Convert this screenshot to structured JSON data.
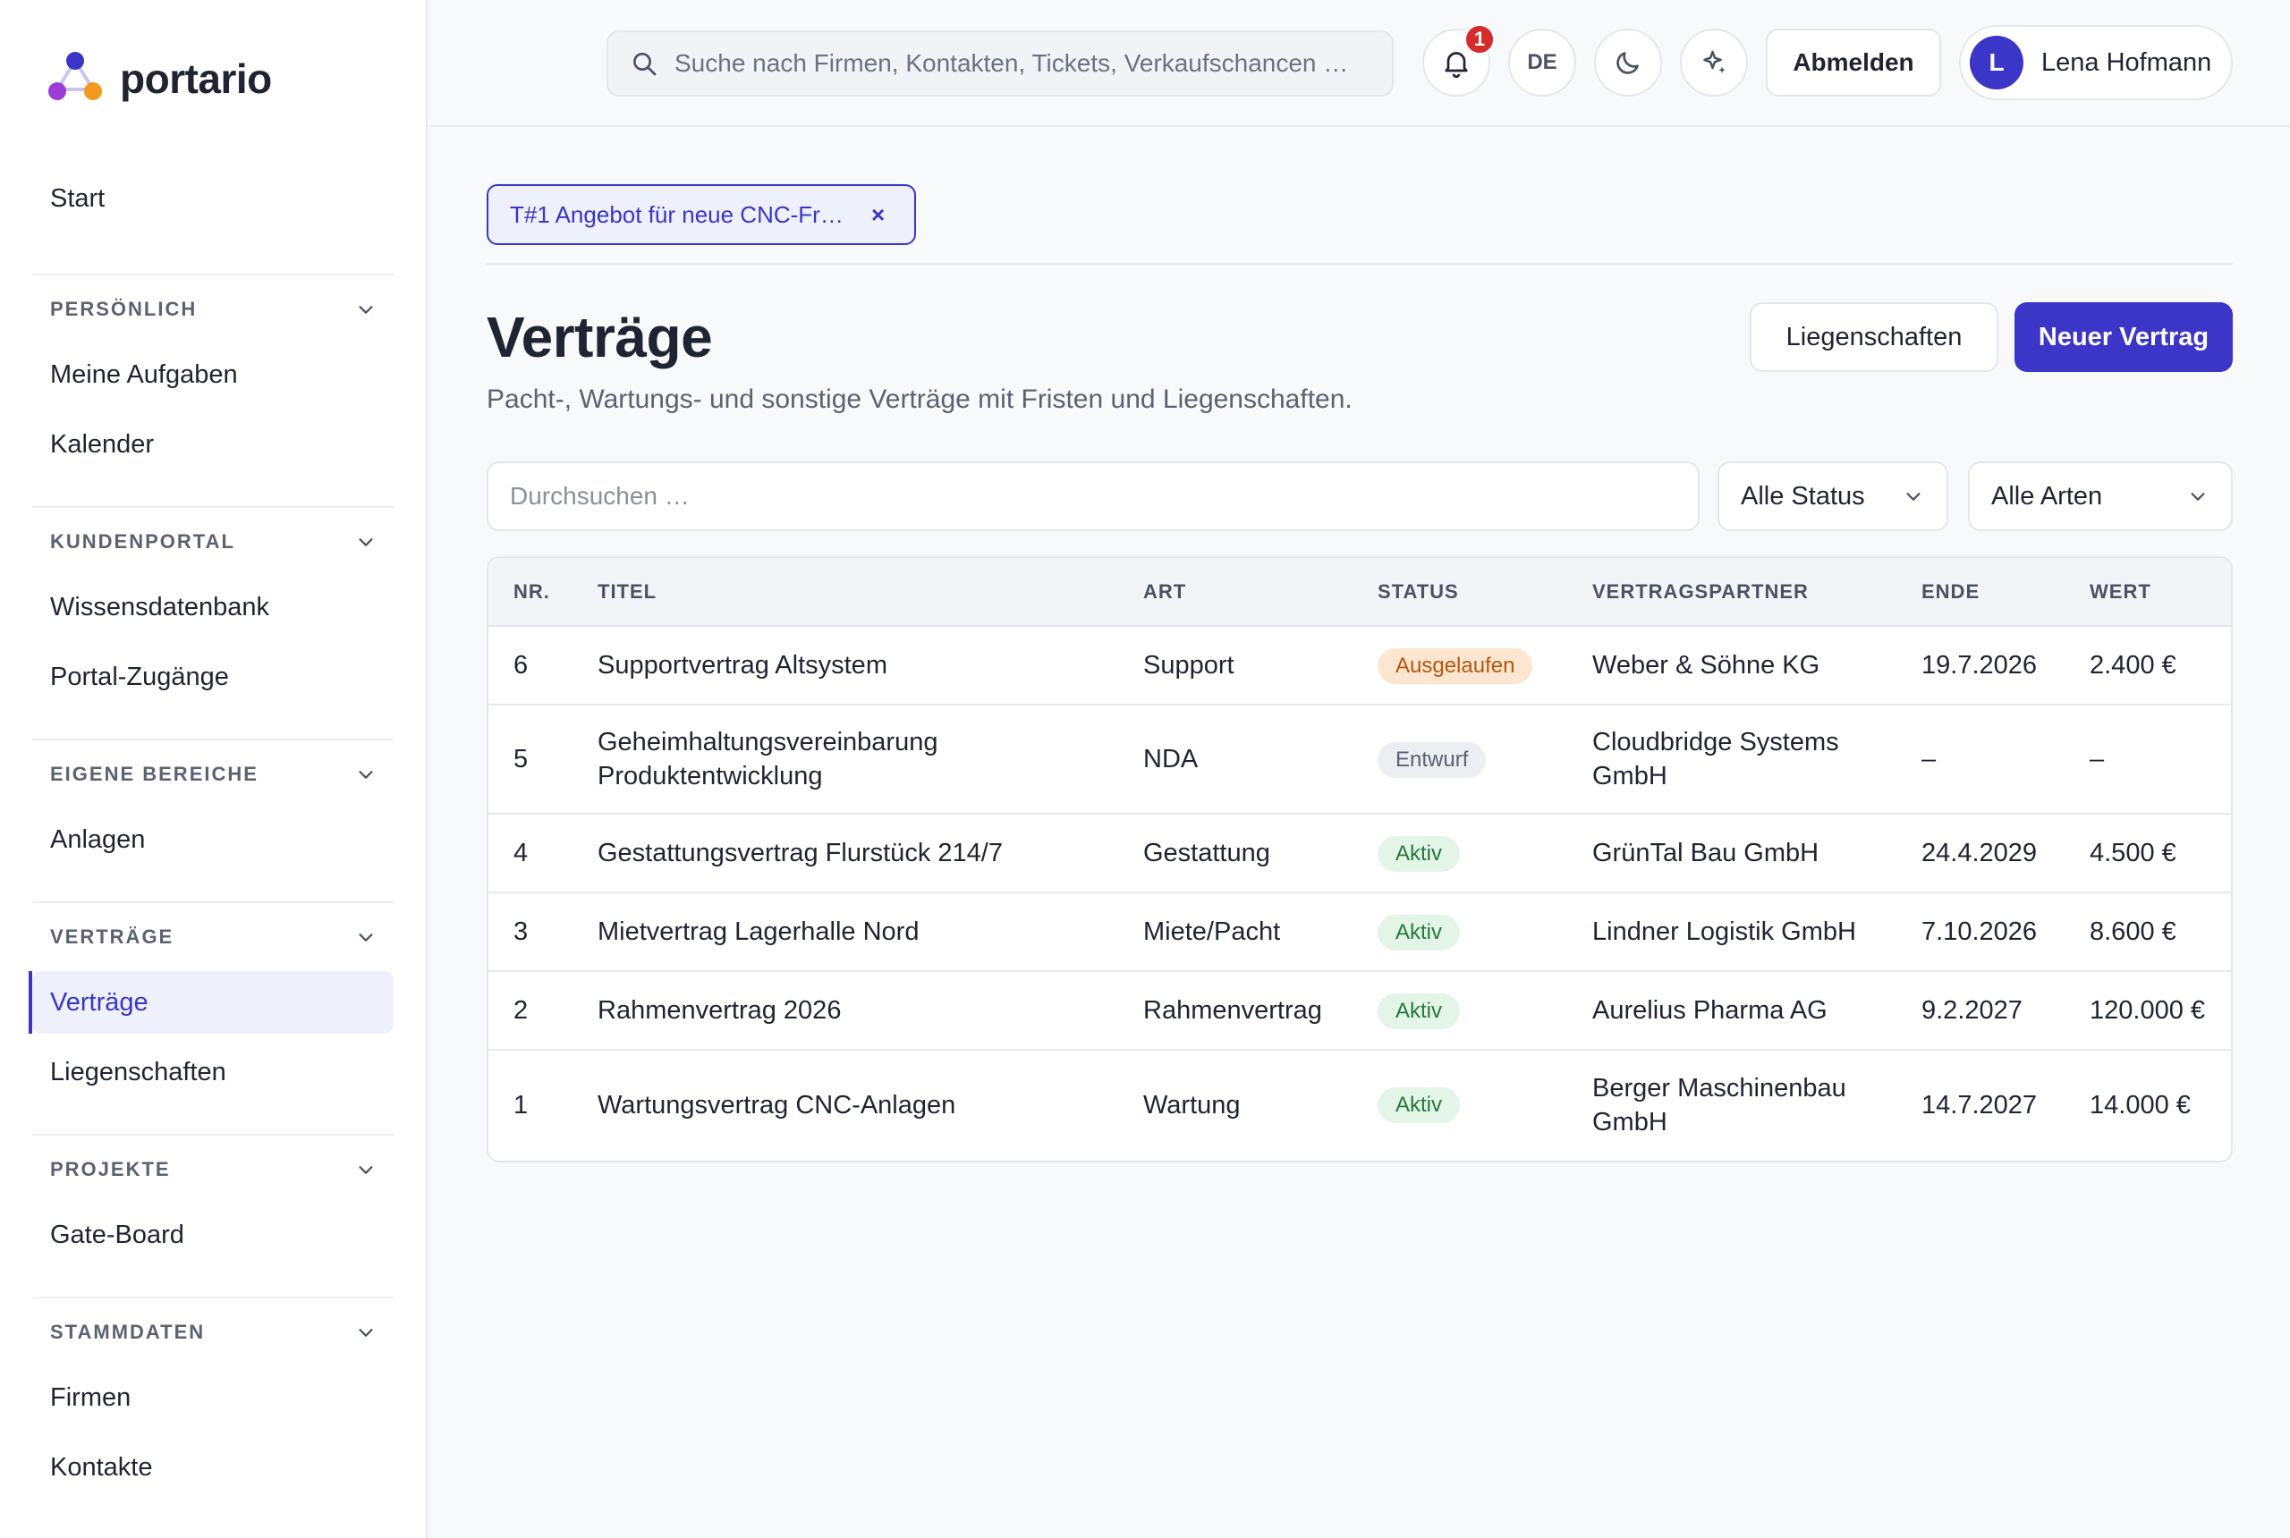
{
  "app": {
    "name": "portario"
  },
  "sidebar": {
    "start": "Start",
    "sections": [
      {
        "label": "PERSÖNLICH",
        "items": [
          "Meine Aufgaben",
          "Kalender"
        ]
      },
      {
        "label": "KUNDENPORTAL",
        "items": [
          "Wissensdatenbank",
          "Portal-Zugänge"
        ]
      },
      {
        "label": "EIGENE BEREICHE",
        "items": [
          "Anlagen"
        ]
      },
      {
        "label": "VERTRÄGE",
        "items": [
          "Verträge",
          "Liegenschaften"
        ]
      },
      {
        "label": "PROJEKTE",
        "items": [
          "Gate-Board"
        ]
      },
      {
        "label": "STAMMDATEN",
        "items": [
          "Firmen",
          "Kontakte"
        ]
      }
    ],
    "active_item": "Verträge"
  },
  "topbar": {
    "search_placeholder": "Suche nach Firmen, Kontakten, Tickets, Verkaufschancen …",
    "notification_count": "1",
    "language": "DE",
    "logout_label": "Abmelden",
    "user_initial": "L",
    "user_name": "Lena Hofmann"
  },
  "open_tab": {
    "label": "T#1 Angebot für neue CNC-Fr…",
    "close": "×"
  },
  "page": {
    "title": "Verträge",
    "subtitle": "Pacht-, Wartungs- und sonstige Verträge mit Fristen und Liegenschaften.",
    "secondary_button": "Liegenschaften",
    "primary_button": "Neuer Vertrag"
  },
  "filters": {
    "search_placeholder": "Durchsuchen …",
    "status_select": "Alle Status",
    "type_select": "Alle Arten"
  },
  "table": {
    "columns": [
      "NR.",
      "TITEL",
      "ART",
      "STATUS",
      "VERTRAGSPARTNER",
      "ENDE",
      "WERT"
    ],
    "rows": [
      {
        "nr": "6",
        "titel": "Supportvertrag Altsystem",
        "art": "Support",
        "status": "Ausgelaufen",
        "partner": "Weber & Söhne KG",
        "ende": "19.7.2026",
        "wert": "2.400 €"
      },
      {
        "nr": "5",
        "titel": "Geheimhaltungsvereinbarung Produktentwicklung",
        "art": "NDA",
        "status": "Entwurf",
        "partner": "Cloudbridge Systems GmbH",
        "ende": "–",
        "wert": "–"
      },
      {
        "nr": "4",
        "titel": "Gestattungsvertrag Flurstück 214/7",
        "art": "Gestattung",
        "status": "Aktiv",
        "partner": "GrünTal Bau GmbH",
        "ende": "24.4.2029",
        "wert": "4.500 €"
      },
      {
        "nr": "3",
        "titel": "Mietvertrag Lagerhalle Nord",
        "art": "Miete/Pacht",
        "status": "Aktiv",
        "partner": "Lindner Logistik GmbH",
        "ende": "7.10.2026",
        "wert": "8.600 €"
      },
      {
        "nr": "2",
        "titel": "Rahmenvertrag 2026",
        "art": "Rahmenvertrag",
        "status": "Aktiv",
        "partner": "Aurelius Pharma AG",
        "ende": "9.2.2027",
        "wert": "120.000 €"
      },
      {
        "nr": "1",
        "titel": "Wartungsvertrag CNC-Anlagen",
        "art": "Wartung",
        "status": "Aktiv",
        "partner": "Berger Maschinenbau GmbH",
        "ende": "14.7.2027",
        "wert": "14.000 €"
      }
    ]
  },
  "colors": {
    "accent": "#3b35c8",
    "status_aktiv": "#237a3a",
    "status_entwurf": "#5b6272",
    "status_ausgelaufen": "#b2570d",
    "badge_red": "#d42b2b"
  }
}
